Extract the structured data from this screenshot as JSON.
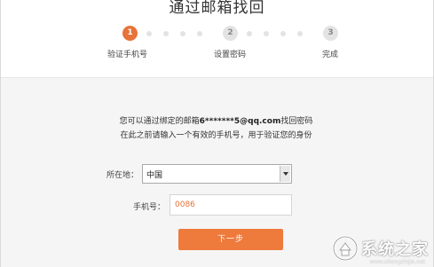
{
  "page": {
    "title": "通过邮箱找回"
  },
  "steps": [
    {
      "number": "1",
      "label": "验证手机号",
      "active": true
    },
    {
      "number": "2",
      "label": "设置密码",
      "active": false
    },
    {
      "number": "3",
      "label": "完成",
      "active": false
    }
  ],
  "instructions": {
    "line1_prefix": "您可以通过绑定的邮箱",
    "email": "6*******5@qq.com",
    "line1_suffix": "找回密码",
    "line2": "在此之前请输入一个有效的手机号，用于验证您的身份"
  },
  "form": {
    "location_label": "所在地：",
    "location_value": "中国",
    "phone_label": "手机号：",
    "phone_value": "0086"
  },
  "actions": {
    "next_label": "下一步"
  },
  "watermark": {
    "text": "系统之家",
    "url": "www.xitongzhijia.net"
  },
  "colors": {
    "accent": "#ee7a3c",
    "step_active": "#e8733a",
    "step_inactive": "#e3e3e3",
    "panel_bg": "#f5f5f5"
  }
}
